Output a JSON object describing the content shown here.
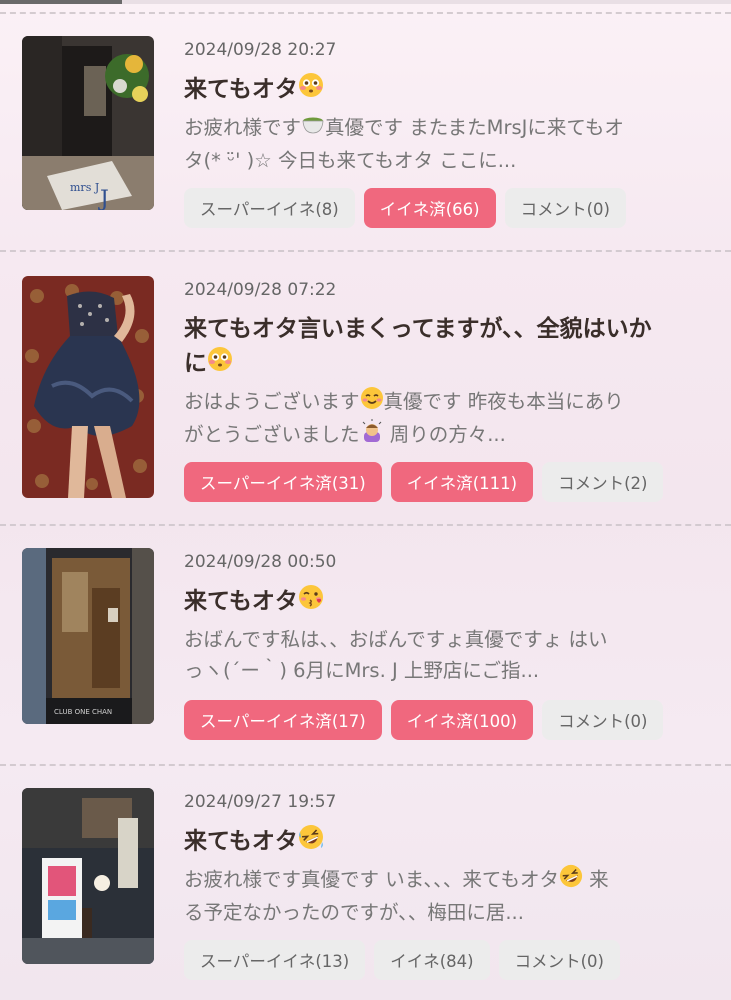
{
  "posts": [
    {
      "date": "2024/09/28 20:27",
      "title": "来てもオタ",
      "title_emoji": "flushed-face",
      "excerpt_line1": "お疲れ様です",
      "excerpt_line1b": "真優です またまたMrsJに来てもオ",
      "excerpt_line2": "タ(* ᵕ̈' )☆ 今日も来てもオタ ここに...",
      "super_like": "スーパーイイネ(8)",
      "like": "イイネ済(66)",
      "comment": "コメント(0)",
      "super_like_active": false,
      "like_active": true,
      "thumb_sign_text": "mrs J"
    },
    {
      "date": "2024/09/28 07:22",
      "title_line1": "来てもオタ言いまくってますが、、全貌はいか",
      "title_line2": "に",
      "title_emoji": "flushed-face",
      "excerpt_line1a": "おはようございます",
      "excerpt_line1b": "真優です 昨夜も本当にあり",
      "excerpt_line2a": "がとうございました",
      "excerpt_line2b": " 周りの方々...",
      "super_like": "スーパーイイネ済(31)",
      "like": "イイネ済(111)",
      "comment": "コメント(2)",
      "super_like_active": true,
      "like_active": true
    },
    {
      "date": "2024/09/28 00:50",
      "title": "来てもオタ",
      "title_emoji": "kissing-face",
      "excerpt_line1": "おばんです私は、、おばんですょ真優ですょ はい",
      "excerpt_line2": "っヽ(´ー｀) 6月にMrs. J 上野店にご指...",
      "super_like": "スーパーイイネ済(17)",
      "like": "イイネ済(100)",
      "comment": "コメント(0)",
      "super_like_active": true,
      "like_active": true,
      "thumb_sign_text": "CLUB ONE CHAN"
    },
    {
      "date": "2024/09/27 19:57",
      "title": "来てもオタ",
      "title_emoji": "rofl-face",
      "excerpt_line1a": "お疲れ様です真優です いま、、、来てもオタ",
      "excerpt_line1b": " 来",
      "excerpt_line2": "る予定なかったのですが、、梅田に居...",
      "super_like": "スーパーイイネ(13)",
      "like": "イイネ(84)",
      "comment": "コメント(0)",
      "super_like_active": false,
      "like_active": false
    }
  ],
  "colors": {
    "active_button": "#f0687e",
    "inactive_button": "#ececec",
    "title": "#3a2e2a"
  }
}
